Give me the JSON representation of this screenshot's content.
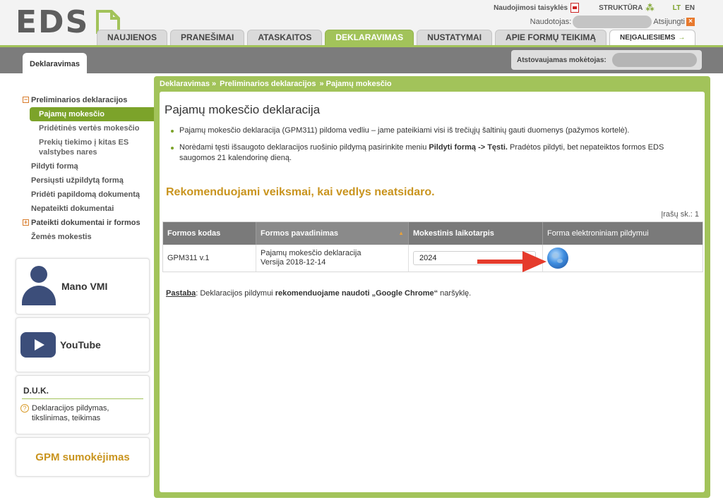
{
  "header": {
    "logo_text": "EDS",
    "top_links": {
      "rules": "Naudojimosi taisyklės",
      "structure": "STRUKTŪRA",
      "lang_lt": "LT",
      "lang_en": "EN"
    },
    "user_label": "Naudotojas:",
    "logout_label": "Atsijungti",
    "nav_tabs": [
      {
        "label": "NAUJIENOS"
      },
      {
        "label": "PRANEŠIMAI"
      },
      {
        "label": "ATASKAITOS"
      },
      {
        "label": "DEKLARAVIMAS"
      },
      {
        "label": "NUSTATYMAI"
      },
      {
        "label": "APIE FORMŲ TEIKIMĄ"
      },
      {
        "label": "NEĮGALIESIEMS"
      }
    ]
  },
  "band": {
    "sub_tab": "Deklaravimas",
    "rep_label": "Atstovaujamas mokėtojas:"
  },
  "left_menu": {
    "items": [
      {
        "label": "Preliminarios deklaracijos"
      },
      {
        "label": "Pajamų mokesčio"
      },
      {
        "label": "Pridėtinės vertės mokesčio"
      },
      {
        "label": "Prekių tiekimo į kitas ES valstybes nares"
      },
      {
        "label": "Pildyti formą"
      },
      {
        "label": "Persiųsti užpildytą formą"
      },
      {
        "label": "Pridėti papildomą dokumentą"
      },
      {
        "label": "Nepateikti dokumentai"
      },
      {
        "label": "Pateikti dokumentai ir formos"
      },
      {
        "label": "Žemės mokestis"
      }
    ],
    "expand_minus": "−",
    "expand_plus": "+"
  },
  "cards": {
    "vmi": "Mano VMI",
    "youtube": "YouTube",
    "duk_title": "D.U.K.",
    "duk_link": "Deklaracijos pildymas, tikslinimas, teikimas",
    "duk_q": "?",
    "gpm": "GPM sumokėjimas"
  },
  "breadcrumb": {
    "p1": "Deklaravimas »",
    "p2": "Preliminarios deklaracijos",
    "p3": "» Pajamų mokesčio"
  },
  "content": {
    "title": "Pajamų mokesčio deklaracija",
    "bullet1": "Pajamų mokesčio deklaracija (GPM311) pildoma vedliu – jame pateikiami visi iš trečiųjų šaltinių gauti duomenys (pažymos kortelė).",
    "bullet2_a": "Norėdami tęsti išsaugoto deklaracijos ruošinio pildymą pasirinkite meniu ",
    "bullet2_b": "Pildyti formą -> Tęsti.",
    "bullet2_c": " Pradėtos pildyti, bet nepateiktos formos EDS saugomos 21 kalendorinę dieną.",
    "rec_title": "Rekomenduojami veiksmai, kai vedlys neatsidaro.",
    "count": "Įrašų sk.: 1",
    "table": {
      "headers": [
        "Formos kodas",
        "Formos pavadinimas",
        "Mokestinis laikotarpis",
        "Forma elektroniniam pildymui"
      ],
      "sort_glyph": "▲",
      "row": {
        "code": "GPM311 v.1",
        "name": "Pajamų mokesčio deklaracija",
        "version": "Versija 2018-12-14",
        "period": "2024"
      }
    },
    "note": {
      "label": "Pastaba",
      "t1": ": Deklaracijos pildymui ",
      "t2": "rekomenduojame naudoti „Google Chrome“",
      "t3": " naršyklę."
    }
  },
  "colors": {
    "brand_green": "#a2c35a",
    "accent_orange": "#c9941e",
    "header_gray": "#7a7a7a",
    "arrow_red": "#e53b2c"
  }
}
